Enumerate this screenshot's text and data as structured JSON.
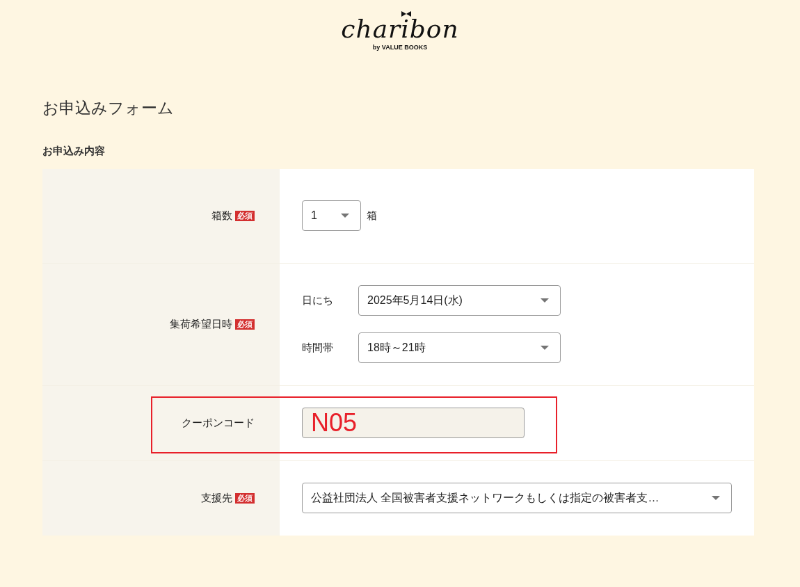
{
  "logo": {
    "name": "charibon",
    "byline": "by VALUE BOOKS"
  },
  "page_title": "お申込みフォーム",
  "section_title": "お申込み内容",
  "rows": [
    {
      "kind": "count",
      "label": "箱数",
      "required_badge": "必須",
      "value": "1",
      "unit": "箱"
    },
    {
      "kind": "datetime",
      "label": "集荷希望日時",
      "required_badge": "必須",
      "fields": [
        {
          "label": "日にち",
          "value": "2025年5月14日(水)"
        },
        {
          "label": "時間帯",
          "value": "18時～21時"
        }
      ]
    },
    {
      "kind": "text",
      "label": "クーポンコード",
      "highlighted": true,
      "value": "N05"
    },
    {
      "kind": "select",
      "label": "支援先",
      "required_badge": "必須",
      "value": "公益社団法人 全国被害者支援ネットワークもしくは指定の被害者支…"
    }
  ]
}
